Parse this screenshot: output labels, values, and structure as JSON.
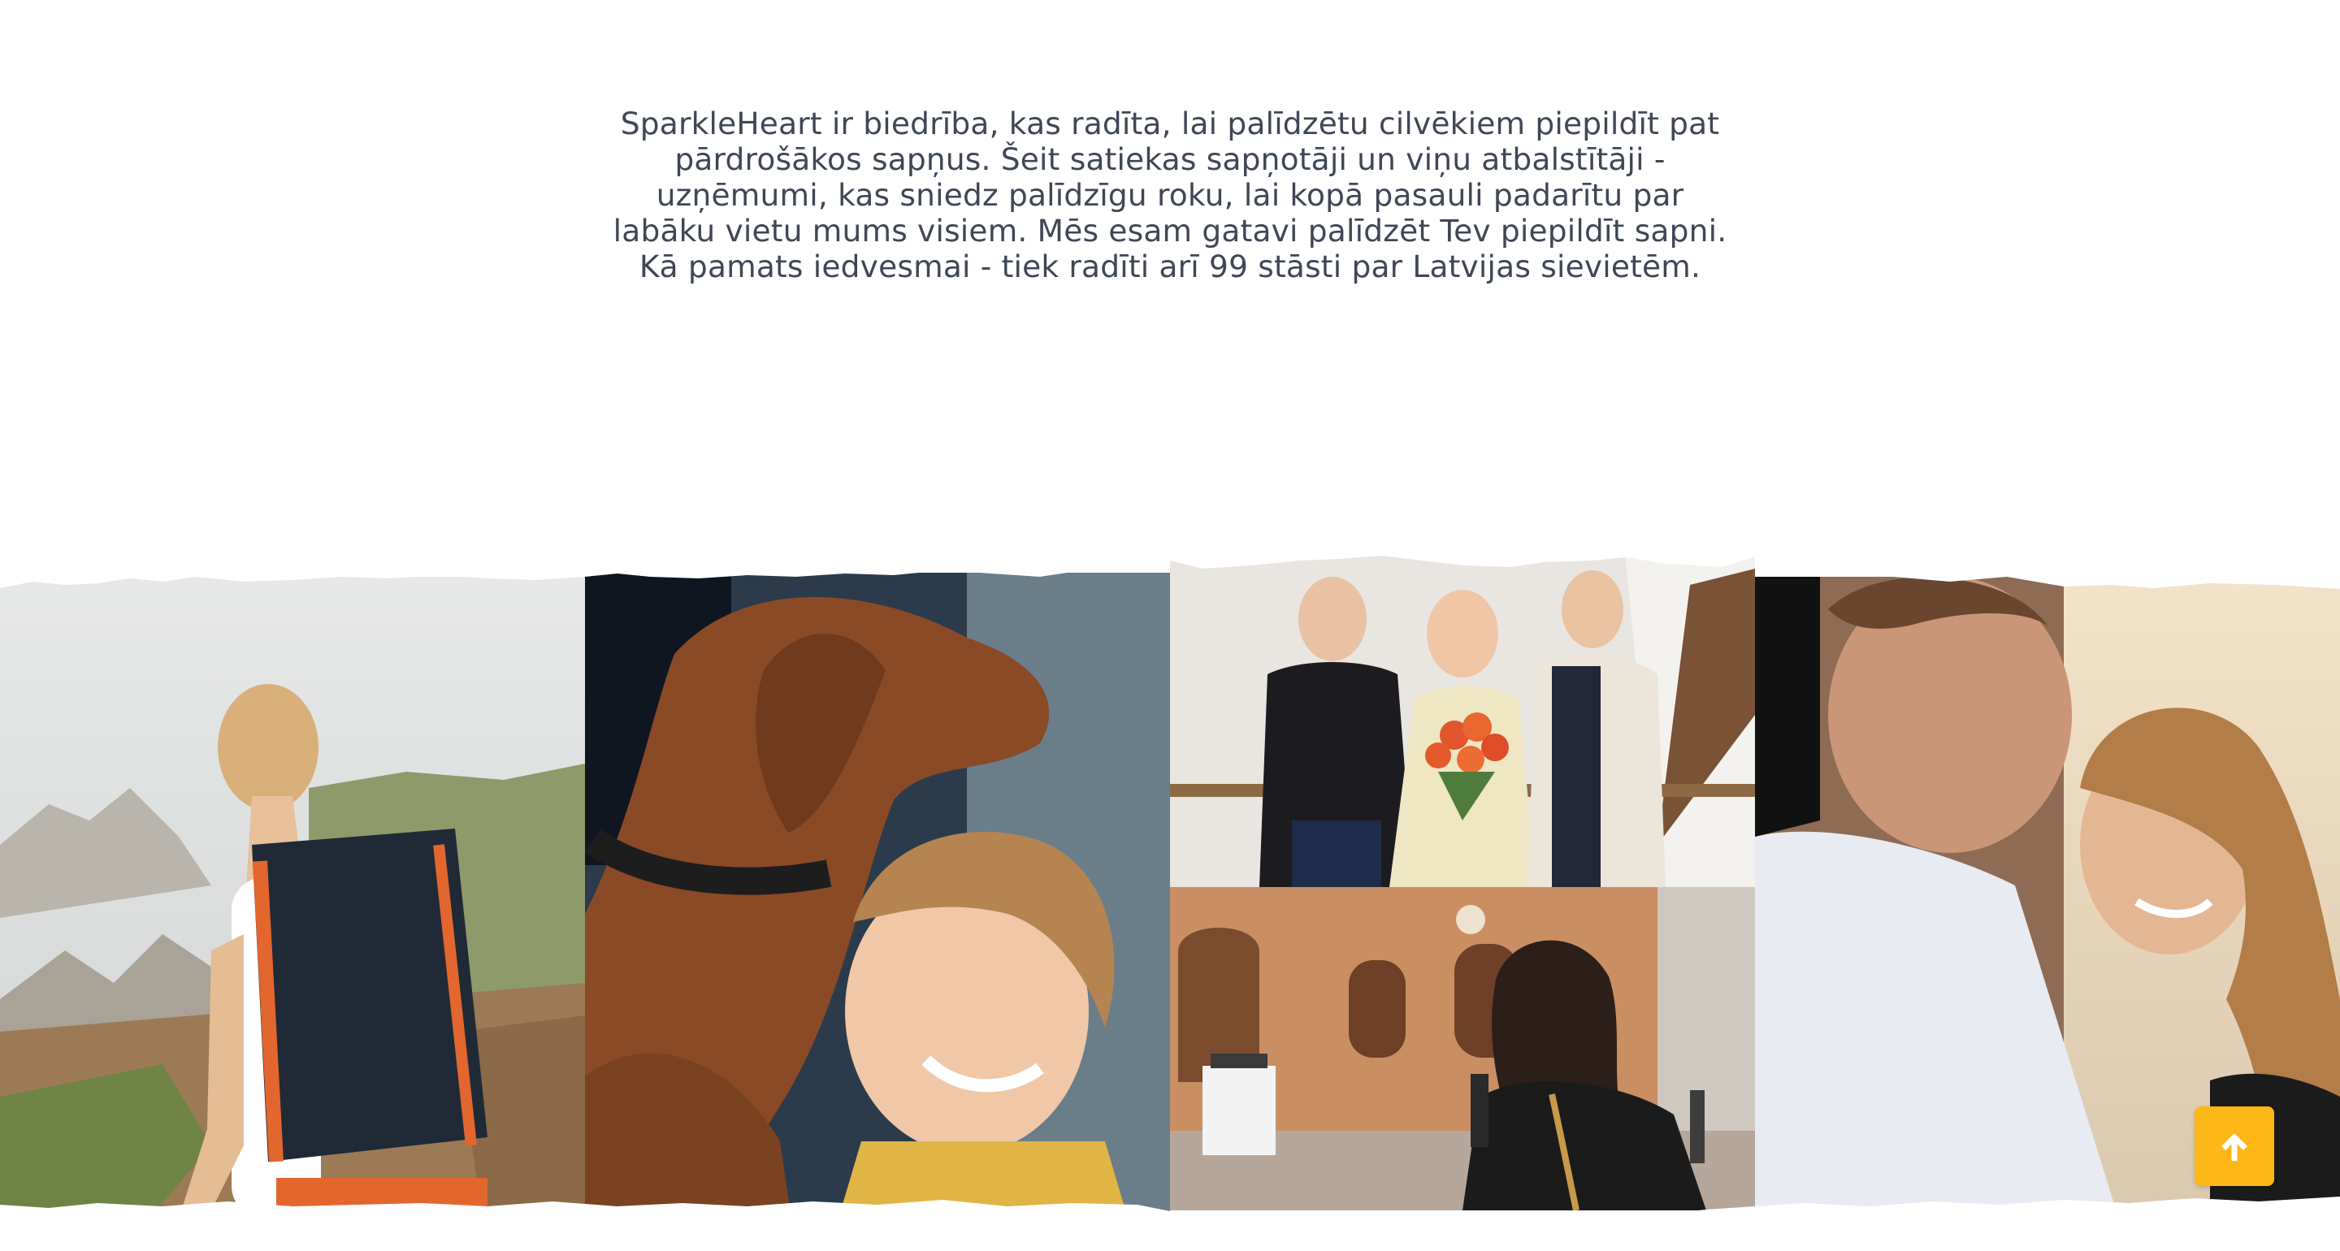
{
  "intro": {
    "lines": [
      "SparkleHeart ir biedrība, kas radīta, lai palīdzētu cilvēkiem piepildīt pat",
      "pārdrošākos sapņus. Šeit satiekas sapņotāji un viņu atbalstītāji -",
      "uzņēmumi, kas sniedz palīdzīgu roku, lai kopā pasauli padarītu par",
      "labāku vietu mums visiem. Mēs esam gatavi palīdzēt Tev piepildīt sapni.",
      "Kā pamats iedvesmai - tiek radīti arī 99 stāsti par Latvijas sievietēm."
    ]
  },
  "gallery": {
    "photos": [
      {
        "name": "photo-hiker-woman-backpack",
        "icon": "hiker-photo"
      },
      {
        "name": "photo-woman-hugging-dog",
        "icon": "dog-hug-photo"
      },
      {
        "name": "photo-three-people-flowers",
        "icon": "group-flowers-photo"
      },
      {
        "name": "photo-woman-city-street",
        "icon": "city-street-photo"
      },
      {
        "name": "photo-couple-laughing",
        "icon": "couple-photo"
      }
    ]
  },
  "colors": {
    "text": "#3f4756",
    "accent": "#fdb716",
    "background": "#ffffff"
  },
  "scroll_top": {
    "icon": "arrow-up-icon"
  }
}
